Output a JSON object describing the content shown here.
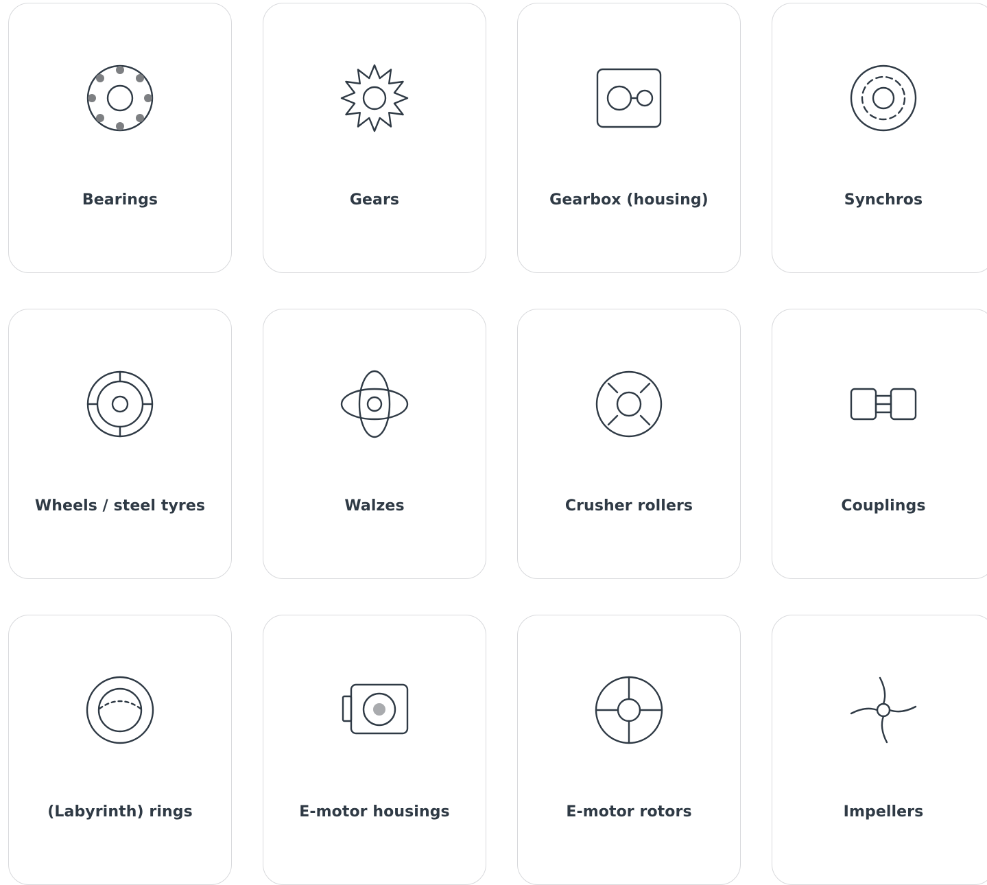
{
  "colors": {
    "text": "#2f3a45",
    "icon_stroke": "#2f3a45",
    "card_border": "#d8d9dc",
    "icon_fill_accent": "#7d7f82"
  },
  "cards": [
    {
      "label": "Bearings",
      "icon": "bearing-icon"
    },
    {
      "label": "Gears",
      "icon": "gear-icon"
    },
    {
      "label": "Gearbox (housing)",
      "icon": "gearbox-housing-icon"
    },
    {
      "label": "Synchros",
      "icon": "synchro-icon"
    },
    {
      "label": "Wheels / steel tyres",
      "icon": "wheel-icon"
    },
    {
      "label": "Walzes",
      "icon": "walze-icon"
    },
    {
      "label": "Crusher rollers",
      "icon": "crusher-roller-icon"
    },
    {
      "label": "Couplings",
      "icon": "coupling-icon"
    },
    {
      "label": "(Labyrinth) rings",
      "icon": "labyrinth-ring-icon"
    },
    {
      "label": "E-motor housings",
      "icon": "e-motor-housing-icon"
    },
    {
      "label": "E-motor rotors",
      "icon": "e-motor-rotor-icon"
    },
    {
      "label": "Impellers",
      "icon": "impeller-icon"
    }
  ]
}
